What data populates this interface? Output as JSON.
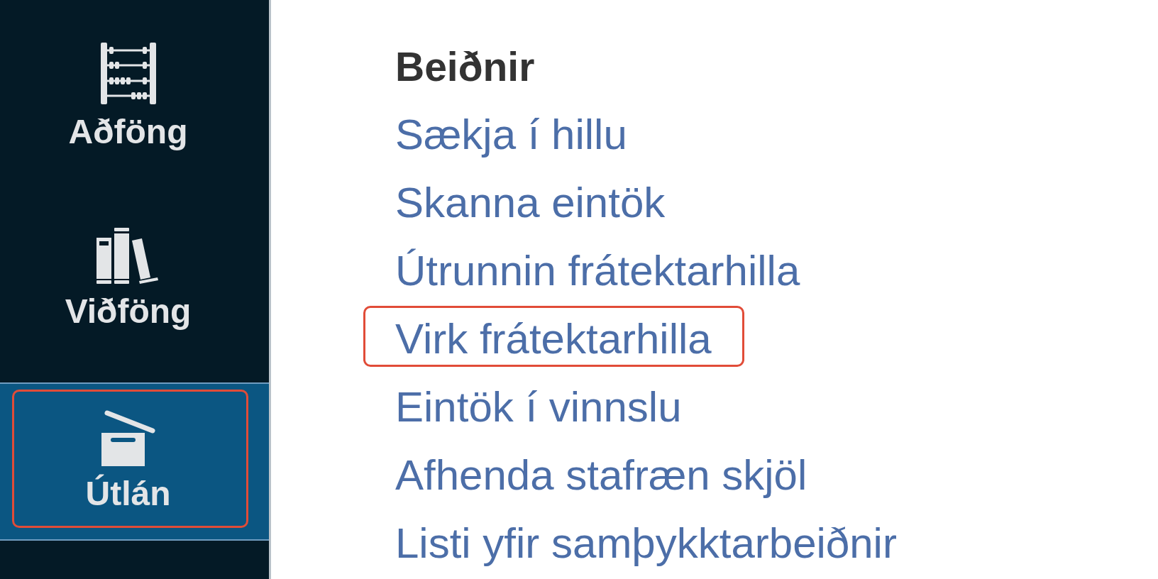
{
  "sidebar": {
    "items": [
      {
        "label": "Aðföng",
        "selected": false,
        "highlighted": false
      },
      {
        "label": "Viðföng",
        "selected": false,
        "highlighted": false
      },
      {
        "label": "Útlán",
        "selected": true,
        "highlighted": true
      }
    ]
  },
  "menu": {
    "heading": "Beiðnir",
    "links": [
      {
        "label": "Sækja í hillu",
        "highlighted": false
      },
      {
        "label": "Skanna eintök",
        "highlighted": false
      },
      {
        "label": "Útrunnin frátektarhilla",
        "highlighted": false
      },
      {
        "label": "Virk frátektarhilla",
        "highlighted": true
      },
      {
        "label": "Eintök í vinnslu",
        "highlighted": false
      },
      {
        "label": "Afhenda stafræn skjöl",
        "highlighted": false
      },
      {
        "label": "Listi yfir samþykktarbeiðnir",
        "highlighted": false
      }
    ]
  }
}
